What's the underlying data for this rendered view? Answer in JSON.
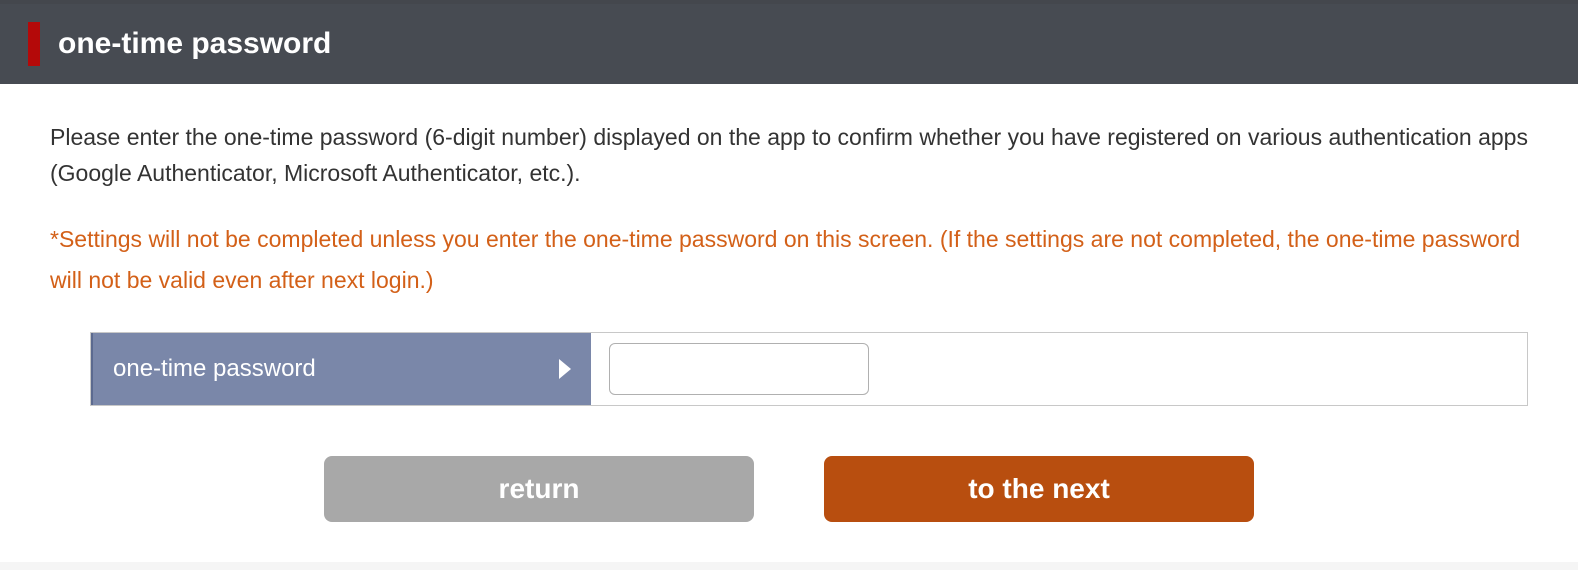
{
  "header": {
    "title": "one-time password"
  },
  "content": {
    "instruction": "Please enter the one-time password (6-digit number) displayed on the app to confirm whether you have registered on various authentication apps (Google Authenticator, Microsoft Authenticator, etc.).",
    "warning": "*Settings will not be completed unless you enter the one-time password on this screen. (If the settings are not completed, the one-time password will not be valid even after next login.)"
  },
  "form": {
    "label": "one-time password",
    "value": ""
  },
  "buttons": {
    "return": "return",
    "next": "to the next"
  }
}
